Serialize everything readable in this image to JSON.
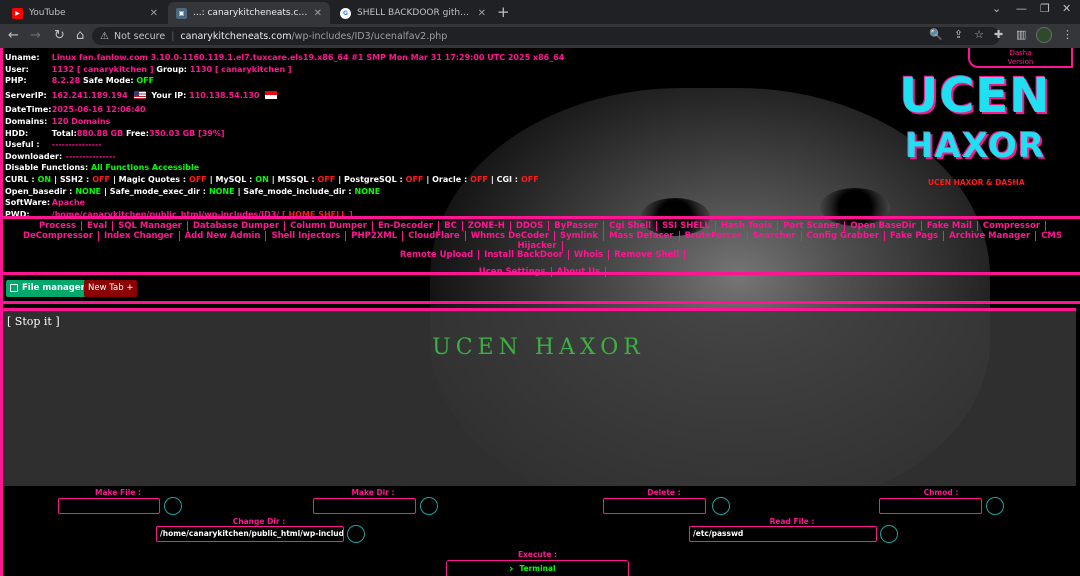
{
  "browser": {
    "tabs": [
      {
        "label": "YouTube",
        "icon": "youtube-icon"
      },
      {
        "label": "...: canarykitcheneats.com ~ UCE",
        "icon": "site-icon"
      },
      {
        "label": "SHELL BACKDOOR github - Penel",
        "icon": "google-icon"
      }
    ],
    "url": {
      "security": "Not secure",
      "host": "canarykitcheneats.com",
      "path": "/wp-includes/ID3/ucenalfav2.php"
    }
  },
  "info": {
    "uname_label": "Uname:",
    "uname": "Linux fan.fanlow.com 3.10.0-1160.119.1.el7.tuxcare.els19.x86_64 #1 SMP Mon Mar 31 17:29:00 UTC 2025 x86_64",
    "user_label": "User:",
    "user": "1132 [ canarykitchen ]",
    "group_label": "Group:",
    "group": "1130 [ canarykitchen ]",
    "php_label": "PHP:",
    "php": "8.2.28",
    "safe_mode_label": "Safe Mode:",
    "safe_mode": "OFF",
    "serverip_label": "ServerIP:",
    "serverip": "162.241.189.194",
    "yourip_label": "Your IP:",
    "yourip": "110.138.54.130",
    "datetime_label": "DateTime:",
    "datetime": "2025-06-16 12:06:40",
    "domains_label": "Domains:",
    "domains": "120 Domains",
    "hdd_label": "HDD:",
    "hdd_total_label": "Total:",
    "hdd_total": "880.88 GB",
    "hdd_free_label": "Free:",
    "hdd_free": "350.03 GB [39%]",
    "useful_label": "Useful :",
    "useful": "---------------",
    "downloader_label": "Downloader:",
    "downloader": "---------------",
    "disable_label": "Disable Functions:",
    "disable": "All Functions Accessible",
    "curl_line": [
      {
        "k": "CURL :",
        "v": "ON",
        "c": "green"
      },
      {
        "k": "| SSH2 :",
        "v": "OFF",
        "c": "red"
      },
      {
        "k": "| Magic Quotes :",
        "v": "OFF",
        "c": "red"
      },
      {
        "k": "| MySQL :",
        "v": "ON",
        "c": "green"
      },
      {
        "k": "| MSSQL :",
        "v": "OFF",
        "c": "red"
      },
      {
        "k": "| PostgreSQL :",
        "v": "OFF",
        "c": "red"
      },
      {
        "k": "| Oracle :",
        "v": "OFF",
        "c": "red"
      },
      {
        "k": "| CGI :",
        "v": "OFF",
        "c": "red"
      }
    ],
    "openbasedir_line": [
      {
        "k": "Open_basedir :",
        "v": "NONE"
      },
      {
        "k": "| Safe_mode_exec_dir :",
        "v": "NONE"
      },
      {
        "k": "| Safe_mode_include_dir :",
        "v": "NONE"
      }
    ],
    "software_label": "SoftWare:",
    "software": "Apache",
    "pwd_label": "PWD:",
    "pwd": "/home/canarykitchen/public_html/wp-includes/ID3/",
    "home_shell": "[ HOME SHELL ]"
  },
  "branding": {
    "dasha_line1": "Dasha",
    "dasha_line2": "Version",
    "logo_line1": "UCEN",
    "logo_line2": "HAXOR",
    "credit": "UCEN HAXOR & DASHA"
  },
  "menu": {
    "row1": [
      "Process",
      "Eval",
      "SQL Manager",
      "Database Dumper",
      "Column Dumper",
      "En-Decoder",
      "BC",
      "ZONE-H",
      "DDOS",
      "ByPasser",
      "Cgi Shell",
      "SSI SHELL",
      "Hash Tools",
      "Port Scaner",
      "Open BaseDir",
      "Fake Mail",
      "Compressor"
    ],
    "row2": [
      "DeCompressor",
      "Index Changer",
      "Add New Admin",
      "Shell Injectors",
      "PHP2XML",
      "CloudFlare",
      "Whmcs DeCoder",
      "Symlink",
      "Mass Defacer",
      "BruteForcer",
      "Searcher",
      "Config Grabber",
      "Fake Pags",
      "Archive Manager",
      "CMS Hijacker"
    ],
    "row3": [
      "Remote Upload",
      "Install BackDoor",
      "Whois",
      "Remove Shell"
    ],
    "row4": [
      "Ucen Settings",
      "About Us"
    ]
  },
  "toolbar": {
    "file_manager": "File manager",
    "new_tab": "New Tab +"
  },
  "terminal": {
    "stop": "[ Stop it ]",
    "title": "UCEN HAXOR"
  },
  "forms": {
    "make_file_label": "Make File :",
    "make_dir_label": "Make Dir :",
    "delete_label": "Delete :",
    "chmod_label": "Chmod :",
    "change_dir_label": "Change Dir :",
    "change_dir_value": "/home/canarykitchen/public_html/wp-includes/I",
    "read_file_label": "Read File :",
    "read_file_value": "/etc/passwd",
    "execute_label": "Execute :",
    "execute_button": "Terminal"
  },
  "colors": {
    "accent": "#ff1493",
    "ok": "#00ff00",
    "off": "#ff1a1a",
    "logo": "#1ee0f0",
    "title": "#3cb043"
  }
}
